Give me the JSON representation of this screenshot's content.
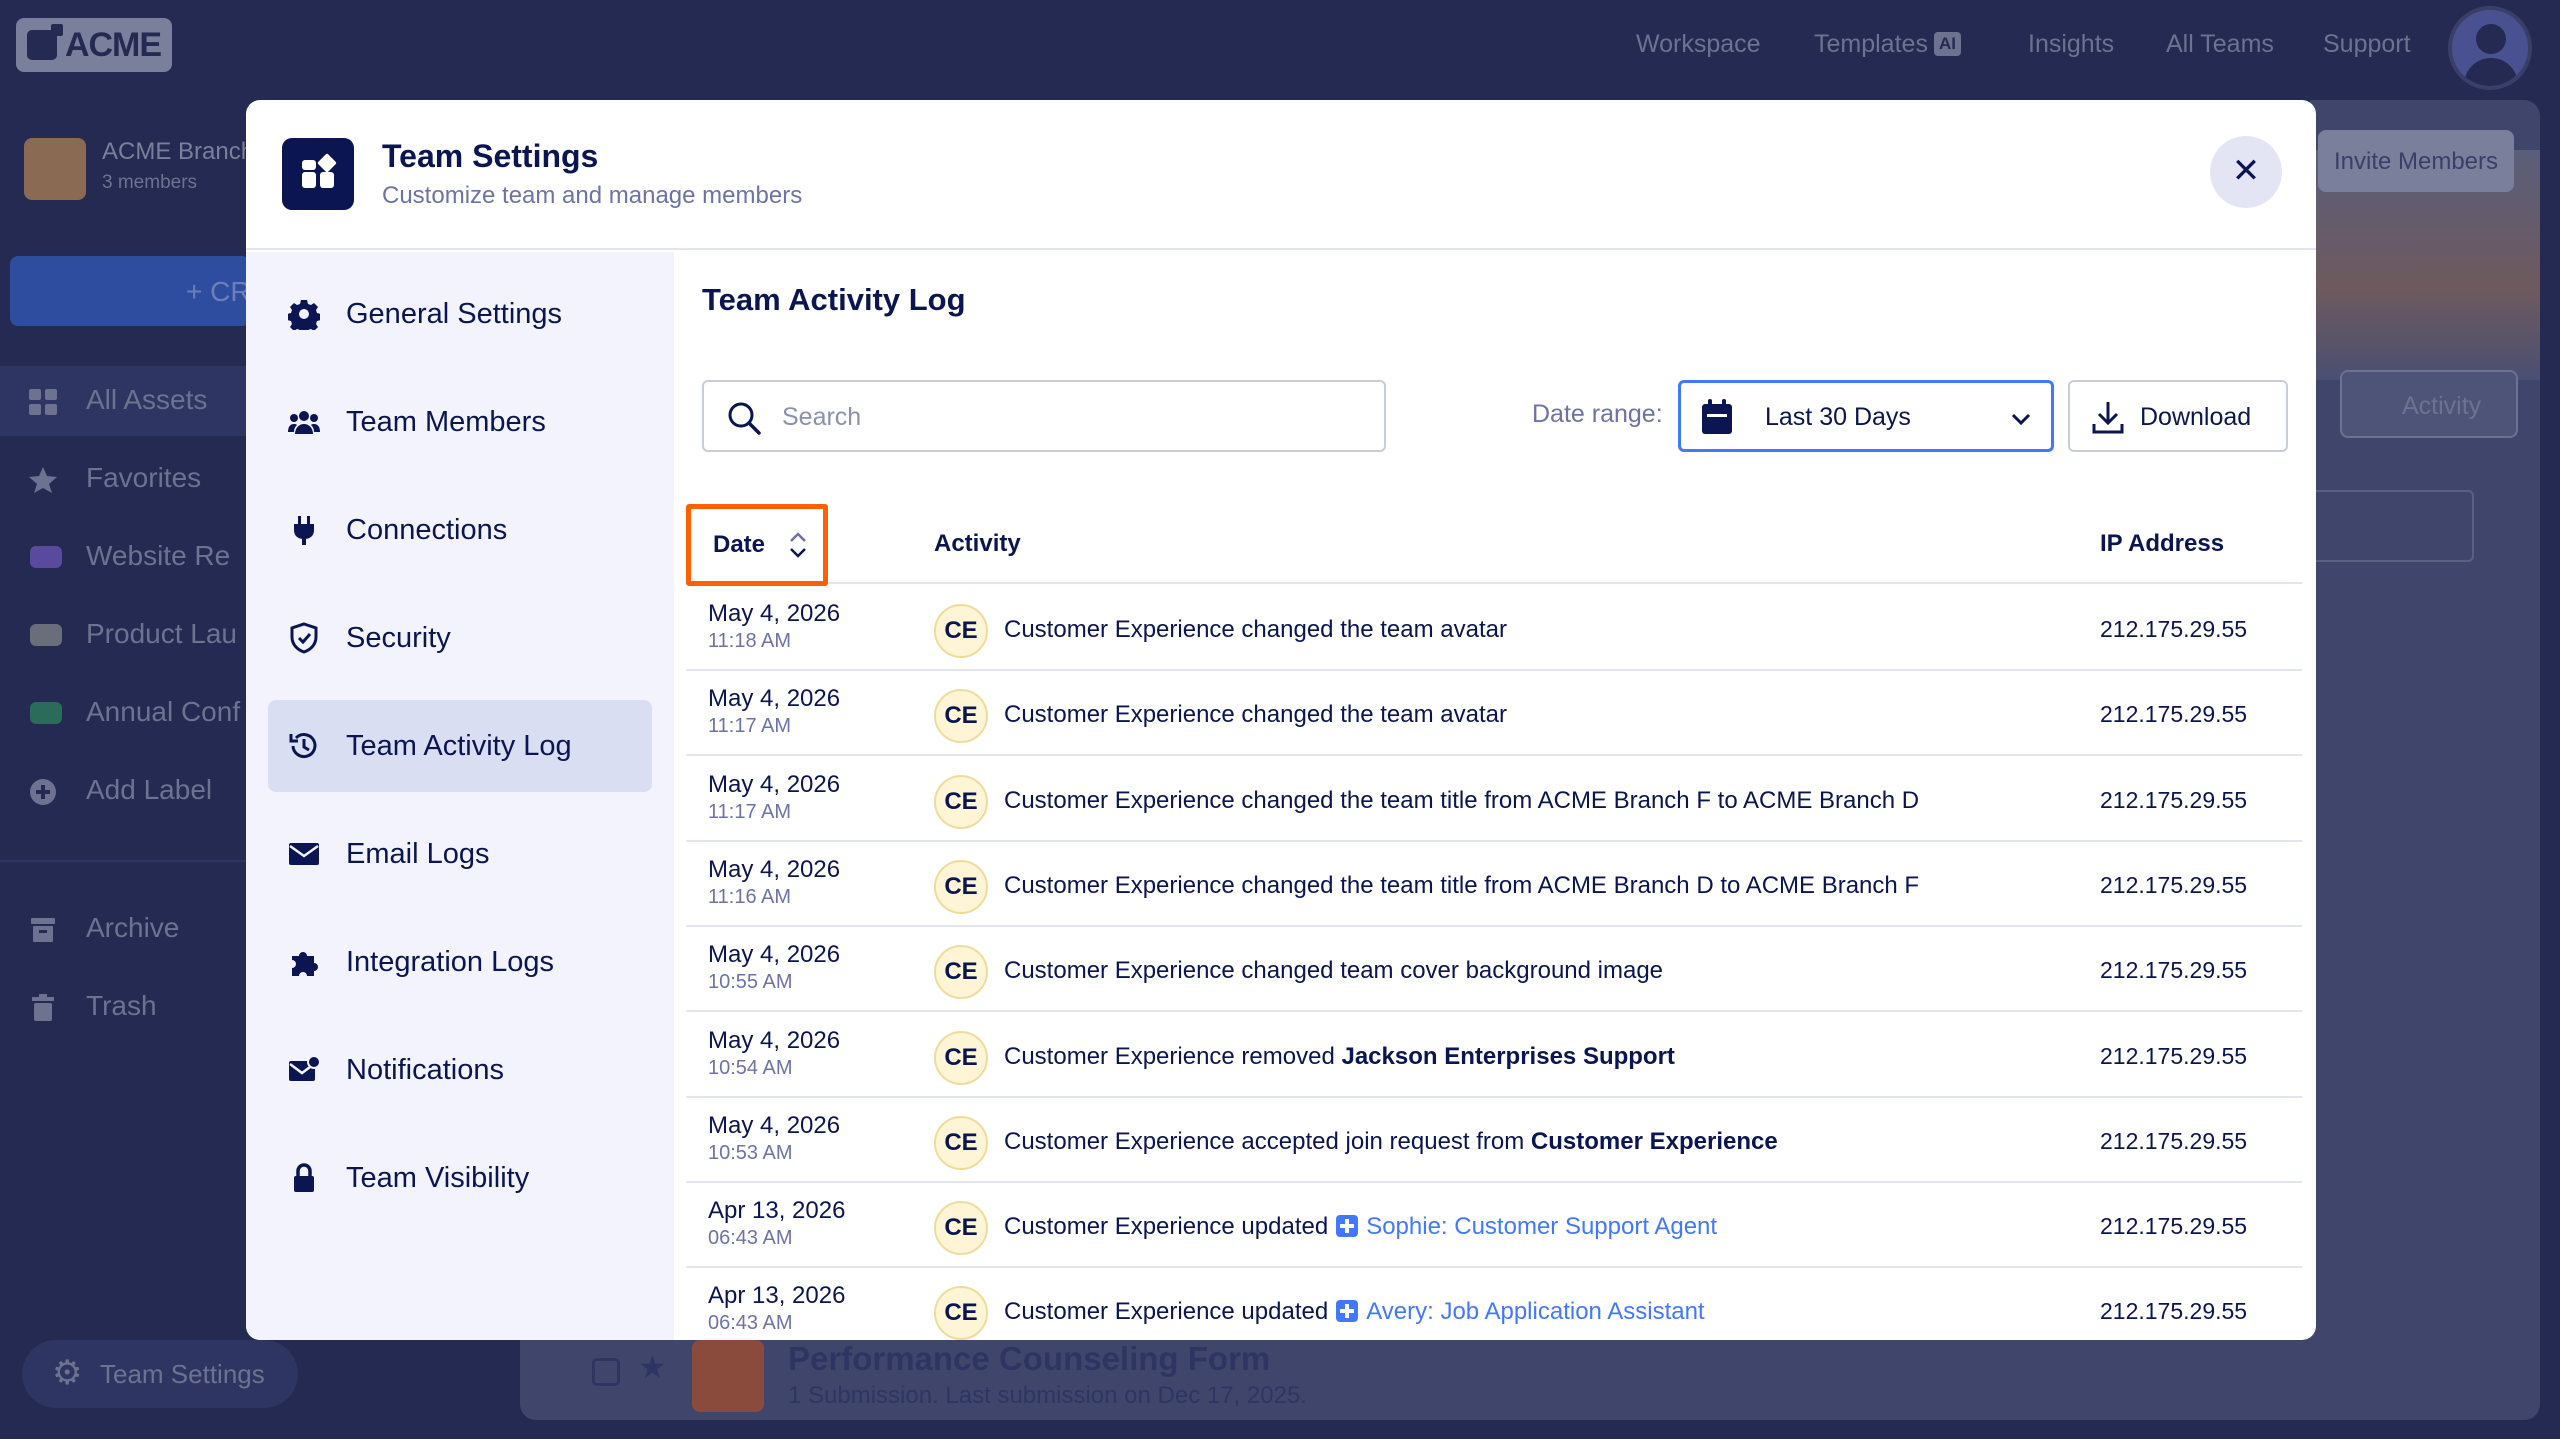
{
  "app": {
    "logo_text": "ACME",
    "nav": [
      "Workspace",
      "Templates",
      "Insights",
      "All Teams",
      "Support"
    ],
    "templates_badge": "AI"
  },
  "sidebar": {
    "team_name": "ACME Branch",
    "team_members": "3 members",
    "create_label": "+ CR",
    "items": [
      {
        "label": "All Assets",
        "icon": "grid-icon"
      },
      {
        "label": "Favorites",
        "icon": "star-icon"
      },
      {
        "label": "Website Re",
        "icon": "label-icon",
        "color": "#7b5bd6"
      },
      {
        "label": "Product Lau",
        "icon": "label-icon",
        "color": "#8a8a8a"
      },
      {
        "label": "Annual Conf",
        "icon": "label-icon",
        "color": "#2f9e6e"
      },
      {
        "label": "Add Label",
        "icon": "plus-circle-icon"
      },
      {
        "label": "Archive",
        "icon": "archive-icon"
      },
      {
        "label": "Trash",
        "icon": "trash-icon"
      }
    ],
    "team_settings_label": "Team Settings"
  },
  "background": {
    "invite_label": "Invite Members",
    "activity_label": "Activity",
    "form_title": "Performance Counseling Form",
    "form_sub": "1 Submission.  Last submission on Dec 17, 2025."
  },
  "modal": {
    "title": "Team Settings",
    "subtitle": "Customize team and manage members",
    "nav": [
      {
        "label": "General Settings",
        "icon": "gear-icon"
      },
      {
        "label": "Team Members",
        "icon": "users-icon"
      },
      {
        "label": "Connections",
        "icon": "plug-icon"
      },
      {
        "label": "Security",
        "icon": "shield-icon"
      },
      {
        "label": "Team Activity Log",
        "icon": "history-icon",
        "active": true
      },
      {
        "label": "Email Logs",
        "icon": "envelope-icon"
      },
      {
        "label": "Integration Logs",
        "icon": "puzzle-icon"
      },
      {
        "label": "Notifications",
        "icon": "mail-bell-icon"
      },
      {
        "label": "Team Visibility",
        "icon": "lock-icon"
      }
    ],
    "content": {
      "title": "Team Activity Log",
      "search_placeholder": "Search",
      "date_range_label": "Date range:",
      "date_range_value": "Last 30 Days",
      "download_label": "Download",
      "columns": {
        "date": "Date",
        "activity": "Activity",
        "ip": "IP Address"
      },
      "rows": [
        {
          "date": "May 4, 2026",
          "time": "11:18 AM",
          "avatar": "CE",
          "text": "Customer Experience changed the team avatar",
          "ip": "212.175.29.55"
        },
        {
          "date": "May 4, 2026",
          "time": "11:17 AM",
          "avatar": "CE",
          "text": "Customer Experience changed the team avatar",
          "ip": "212.175.29.55"
        },
        {
          "date": "May 4, 2026",
          "time": "11:17 AM",
          "avatar": "CE",
          "text": "Customer Experience changed the team title from ACME Branch F to ACME Branch D",
          "ip": "212.175.29.55"
        },
        {
          "date": "May 4, 2026",
          "time": "11:16 AM",
          "avatar": "CE",
          "text": "Customer Experience changed the team title from ACME Branch D to ACME Branch F",
          "ip": "212.175.29.55"
        },
        {
          "date": "May 4, 2026",
          "time": "10:55 AM",
          "avatar": "CE",
          "text": "Customer Experience changed team cover background image",
          "ip": "212.175.29.55"
        },
        {
          "date": "May 4, 2026",
          "time": "10:54 AM",
          "avatar": "CE",
          "text": "Customer Experience removed ",
          "bold": "Jackson Enterprises Support",
          "ip": "212.175.29.55"
        },
        {
          "date": "May 4, 2026",
          "time": "10:53 AM",
          "avatar": "CE",
          "text": "Customer Experience accepted join request from ",
          "bold": "Customer Experience",
          "ip": "212.175.29.55"
        },
        {
          "date": "Apr 13, 2026",
          "time": "06:43 AM",
          "avatar": "CE",
          "text": "Customer Experience updated",
          "link": "Sophie: Customer Support Agent",
          "ip": "212.175.29.55"
        },
        {
          "date": "Apr 13, 2026",
          "time": "06:43 AM",
          "avatar": "CE",
          "text": "Customer Experience updated",
          "link": "Avery: Job Application Assistant",
          "ip": "212.175.29.55"
        }
      ]
    }
  },
  "colors": {
    "accent": "#4277ff",
    "sort_highlight": "#ff6100",
    "navy": "#0a1551"
  }
}
